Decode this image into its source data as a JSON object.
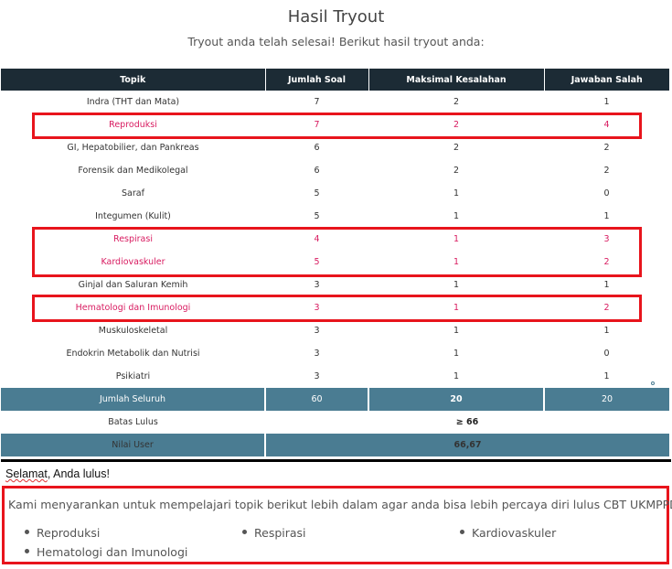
{
  "header": {
    "title": "Hasil Tryout",
    "subtitle": "Tryout anda telah selesai! Berikut hasil tryout anda:"
  },
  "table": {
    "columns": [
      "Topik",
      "Jumlah Soal",
      "Maksimal Kesalahan",
      "Jawaban Salah"
    ],
    "rows": [
      {
        "topic": "Indra (THT dan Mata)",
        "count": "7",
        "max": "2",
        "wrong": "1",
        "highlight": false
      },
      {
        "topic": "Reproduksi",
        "count": "7",
        "max": "2",
        "wrong": "4",
        "highlight": true
      },
      {
        "topic": "GI, Hepatobilier, dan Pankreas",
        "count": "6",
        "max": "2",
        "wrong": "2",
        "highlight": false
      },
      {
        "topic": "Forensik dan Medikolegal",
        "count": "6",
        "max": "2",
        "wrong": "2",
        "highlight": false
      },
      {
        "topic": "Saraf",
        "count": "5",
        "max": "1",
        "wrong": "0",
        "highlight": false
      },
      {
        "topic": "Integumen (Kulit)",
        "count": "5",
        "max": "1",
        "wrong": "1",
        "highlight": false
      },
      {
        "topic": "Respirasi",
        "count": "4",
        "max": "1",
        "wrong": "3",
        "highlight": true
      },
      {
        "topic": "Kardiovaskuler",
        "count": "5",
        "max": "1",
        "wrong": "2",
        "highlight": true
      },
      {
        "topic": "Ginjal dan Saluran Kemih",
        "count": "3",
        "max": "1",
        "wrong": "1",
        "highlight": false
      },
      {
        "topic": "Hematologi dan Imunologi",
        "count": "3",
        "max": "1",
        "wrong": "2",
        "highlight": true
      },
      {
        "topic": "Muskuloskeletal",
        "count": "3",
        "max": "1",
        "wrong": "1",
        "highlight": false
      },
      {
        "topic": "Endokrin Metabolik dan Nutrisi",
        "count": "3",
        "max": "1",
        "wrong": "0",
        "highlight": false
      },
      {
        "topic": "Psikiatri",
        "count": "3",
        "max": "1",
        "wrong": "1",
        "highlight": false
      }
    ],
    "total": {
      "label": "Jumlah Seluruh",
      "count": "60",
      "max": "20",
      "wrong": "20"
    },
    "pass": {
      "label": "Batas Lulus",
      "value": "≥ 66"
    },
    "user": {
      "label": "Nilai User",
      "value": "66,67"
    }
  },
  "result": {
    "congrats_word": "Selamat",
    "congrats_rest": ", Anda lulus!"
  },
  "recommendation": {
    "intro": "Kami menyarankan untuk mempelajari topik berikut lebih dalam agar anda bisa lebih percaya diri lulus CBT UKMPPD:",
    "items": [
      "Reproduksi",
      "Respirasi",
      "Kardiovaskuler",
      "Hematologi dan Imunologi"
    ]
  },
  "colors": {
    "header_bg": "#1c2b35",
    "total_bg": "#4a7c92",
    "highlight_text": "#d81b60",
    "annotation_red": "#e8141c"
  }
}
